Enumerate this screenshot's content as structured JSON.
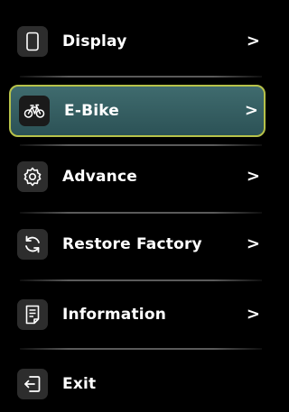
{
  "menu": {
    "items": [
      {
        "label": "Display",
        "icon": "display-icon",
        "arrow": ">"
      },
      {
        "label": "E-Bike",
        "icon": "bicycle-icon",
        "arrow": ">",
        "selected": true
      },
      {
        "label": "Advance",
        "icon": "gear-icon",
        "arrow": ">"
      },
      {
        "label": "Restore Factory",
        "icon": "restore-icon",
        "arrow": ">"
      },
      {
        "label": "Information",
        "icon": "document-icon",
        "arrow": ">"
      },
      {
        "label": "Exit",
        "icon": "exit-icon"
      }
    ]
  },
  "colors": {
    "background": "#000000",
    "selected_fill": "#3f6b6e",
    "selected_border": "#b7c24a",
    "icon_box": "#2d2d2d",
    "text": "#ffffff"
  }
}
